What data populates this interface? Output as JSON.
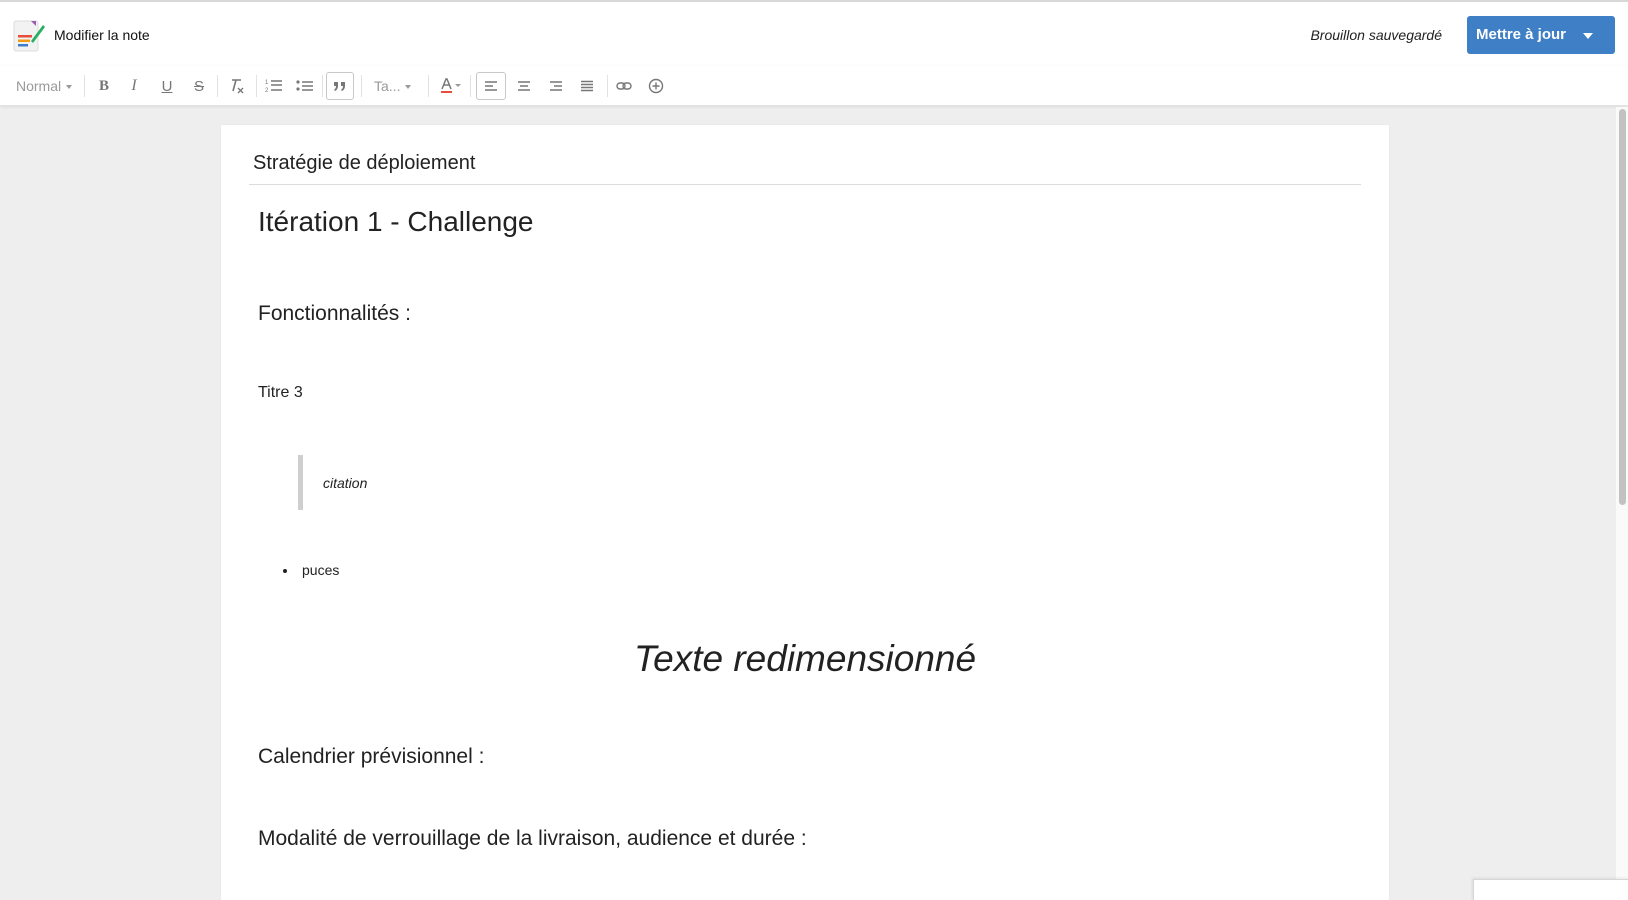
{
  "header": {
    "app_title": "Modifier la note",
    "save_status": "Brouillon sauvegardé",
    "update_button": "Mettre à jour"
  },
  "toolbar": {
    "format_select": "Normal",
    "bold": "B",
    "italic": "I",
    "underline": "U",
    "strike": "S",
    "size_select": "Ta...",
    "active_align": "left"
  },
  "document": {
    "title": "Stratégie de déploiement",
    "heading1": "Itération 1 - Challenge",
    "heading2_features": "Fonctionnalités :",
    "heading3": "Titre 3",
    "quote": "citation",
    "bullet": "puces",
    "resized_text": "Texte redimensionné",
    "heading2_schedule": "Calendrier prévisionnel :",
    "heading2_lock": "Modalité de verrouillage de la livraison, audience et durée :"
  },
  "colors": {
    "accent": "#3f7fc6",
    "page_background": "#eeeeee",
    "text_color_underline": "#e74c3c"
  }
}
